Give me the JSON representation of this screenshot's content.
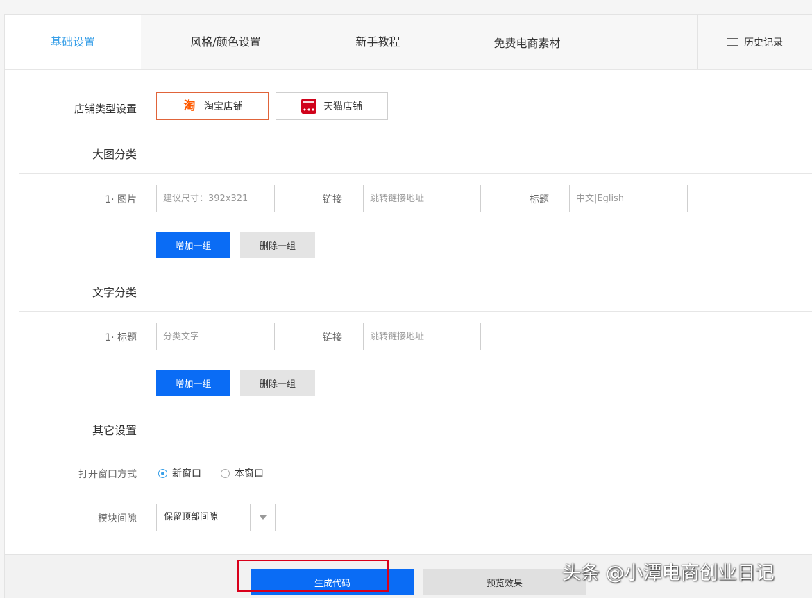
{
  "nav": {
    "tabs": [
      "基础设置",
      "风格/颜色设置",
      "新手教程",
      "免费电商素材"
    ],
    "history": "历史记录"
  },
  "shop_type": {
    "label": "店铺类型设置",
    "taobao_icon_text": "淘",
    "taobao": "淘宝店铺",
    "tmall": "天猫店铺"
  },
  "big_image": {
    "title": "大图分类",
    "row_label": "1· 图片",
    "image_placeholder": "建议尺寸：392x321",
    "link_label": "链接",
    "link_placeholder": "跳转链接地址",
    "title_label": "标题",
    "title_placeholder": "中文|Eglish",
    "add": "增加一组",
    "delete": "删除一组"
  },
  "text_category": {
    "title": "文字分类",
    "row_label": "1· 标题",
    "text_placeholder": "分类文字",
    "link_label": "链接",
    "link_placeholder": "跳转链接地址",
    "add": "增加一组",
    "delete": "删除一组"
  },
  "other": {
    "title": "其它设置",
    "open_label": "打开窗口方式",
    "new_window": "新窗口",
    "same_window": "本窗口",
    "gap_label": "模块间隙",
    "gap_value": "保留顶部间隙"
  },
  "footer": {
    "generate": "生成代码",
    "preview": "预览效果"
  },
  "watermark": "头条 @小潭电商创业日记",
  "colors": {
    "primary": "#0a6cf5",
    "active_tab": "#3aa0e8",
    "highlight": "#d9001b"
  }
}
